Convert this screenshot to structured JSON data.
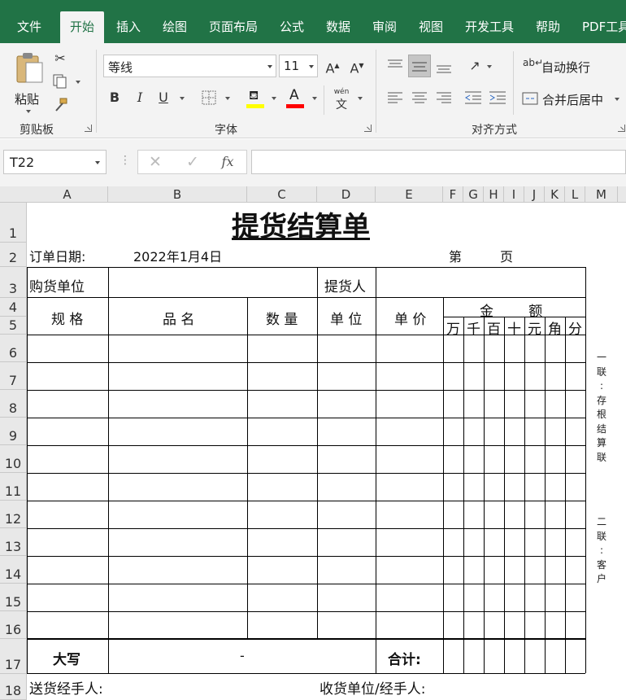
{
  "ribbon": {
    "tabs": [
      "文件",
      "开始",
      "插入",
      "绘图",
      "页面布局",
      "公式",
      "数据",
      "审阅",
      "视图",
      "开发工具",
      "帮助",
      "PDF工具"
    ],
    "active_tab": "开始",
    "clipboard": {
      "paste_label": "粘贴",
      "group_label": "剪贴板"
    },
    "font": {
      "font_name": "等线",
      "font_size": "11",
      "group_label": "字体",
      "bold": "B",
      "italic": "I",
      "underline": "U",
      "fx_color": "#ff0000",
      "fill_color": "#ffff00"
    },
    "alignment": {
      "wrap_label": "自动换行",
      "merge_label": "合并后居中",
      "group_label": "对齐方式"
    }
  },
  "formula_bar": {
    "name_box": "T22",
    "fx": "fx",
    "value": ""
  },
  "columns": [
    "A",
    "B",
    "C",
    "D",
    "E",
    "F",
    "G",
    "H",
    "I",
    "J",
    "K",
    "L",
    "M"
  ],
  "rows": [
    "1",
    "2",
    "3",
    "4",
    "5",
    "6",
    "7",
    "8",
    "9",
    "10",
    "11",
    "12",
    "13",
    "14",
    "15",
    "16",
    "17",
    "18"
  ],
  "sheet": {
    "title": "提货结算单",
    "order_date_label": "订单日期:",
    "order_date": "2022年1月4日",
    "page_label_1": "第",
    "page_label_2": "页",
    "buyer_label": "购货单位",
    "picker_label": "提货人",
    "headers": {
      "spec": "规 格",
      "name": "品 名",
      "qty": "数 量",
      "unit": "单 位",
      "price": "单 价",
      "amount": "金        额"
    },
    "amount_digits": [
      "万",
      "千",
      "百",
      "十",
      "元",
      "角",
      "分"
    ],
    "daxie_label": "大写",
    "daxie_value": "-",
    "total_label": "合计:",
    "deliver_label": "送货经手人:",
    "receiver_label": "收货单位/经手人:",
    "side_note_1": [
      "一",
      "联",
      ":",
      "存",
      "根",
      "结",
      "算",
      "联"
    ],
    "side_note_2": [
      "二",
      "联",
      ":",
      "客",
      "户"
    ]
  }
}
